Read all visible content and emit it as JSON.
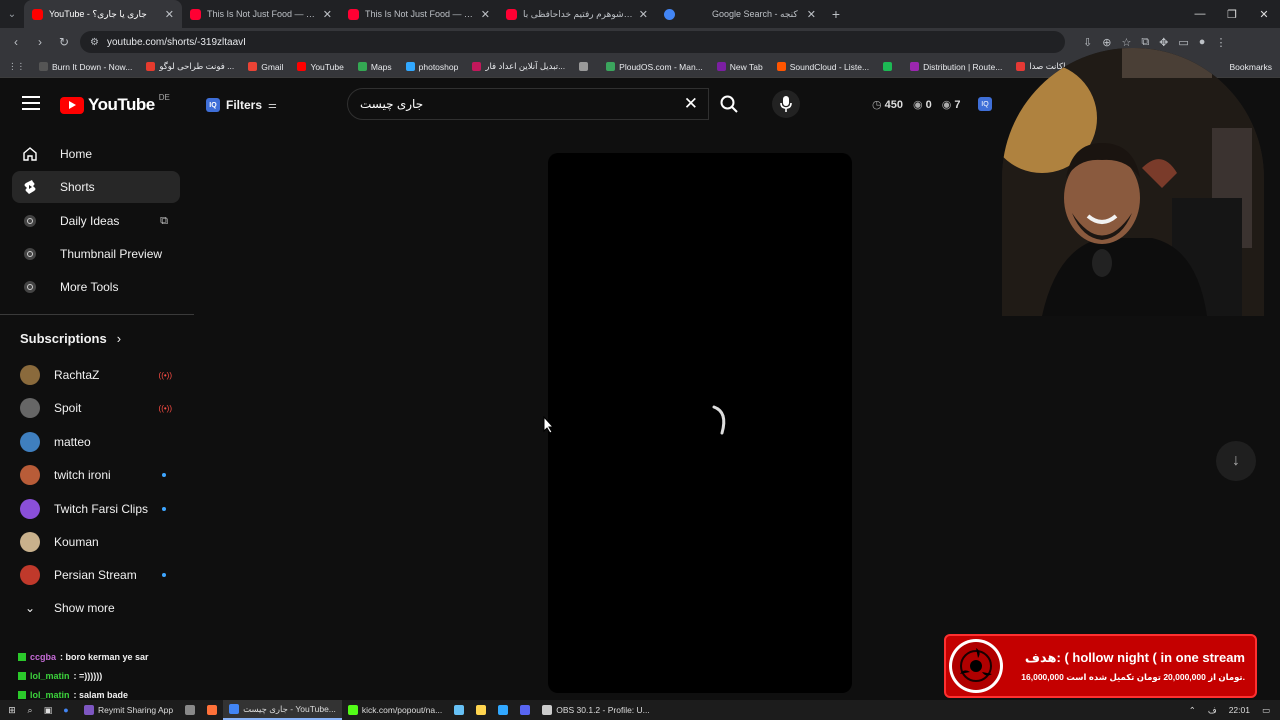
{
  "browser": {
    "tabs": [
      {
        "title": "YouTube - جاری یا جاری؟",
        "color": "#ff0000",
        "active": true
      },
      {
        "title": "This Is Not Just Food — This Is",
        "color": "#ff0033",
        "active": false
      },
      {
        "title": "This Is Not Just Food — This Is",
        "color": "#ff0033",
        "active": false
      },
      {
        "title": "با مادرشوهرم رفتیم خداحافظی با",
        "color": "#ff0033",
        "active": false
      },
      {
        "title": "",
        "color": "#4285f4",
        "active": false
      },
      {
        "title": "Google Search - کنجه",
        "color": "#4285f4",
        "active": false
      }
    ],
    "url": "youtube.com/shorts/-319zltaavI",
    "bookmarks": [
      {
        "label": "Burn It Down - Now...",
        "color": "#555"
      },
      {
        "label": "فونت طراحی لوگو ...",
        "color": "#e63b2e"
      },
      {
        "label": "Gmail",
        "color": "#ea4335"
      },
      {
        "label": "YouTube",
        "color": "#ff0000"
      },
      {
        "label": "Maps",
        "color": "#34a853"
      },
      {
        "label": "photoshop",
        "color": "#31a8ff"
      },
      {
        "label": "تبدیل آنلاین اعداد فار...",
        "color": "#c2185b"
      },
      {
        "label": "",
        "color": "#999"
      },
      {
        "label": "PloudOS.com - Man...",
        "color": "#3ba55d"
      },
      {
        "label": "New Tab",
        "color": "#7b1fa2"
      },
      {
        "label": "SoundCloud - Liste...",
        "color": "#ff5500"
      },
      {
        "label": "",
        "color": "#1db954"
      },
      {
        "label": "Distribution | Route...",
        "color": "#9c27b0"
      },
      {
        "label": "اکانت صدا...",
        "color": "#e53935"
      }
    ],
    "bookmarks_more": "Bookmarks"
  },
  "youtube": {
    "logo_text": "YouTube",
    "region": "DE",
    "filters_label": "Filters",
    "search_value": "جاری چیست",
    "stats": {
      "time": "450",
      "views": "0",
      "watched": "7"
    }
  },
  "sidebar": {
    "items": [
      {
        "label": "Home",
        "icon": "home-icon"
      },
      {
        "label": "Shorts",
        "icon": "shorts-icon",
        "selected": true
      },
      {
        "label": "Daily Ideas",
        "icon": "iq-icon"
      },
      {
        "label": "Thumbnail Preview",
        "icon": "iq-icon"
      },
      {
        "label": "More Tools",
        "icon": "iq-icon"
      }
    ],
    "subscriptions_label": "Subscriptions",
    "subscriptions": [
      {
        "name": "RachtaZ",
        "status": "live",
        "color": "#8a6a3c"
      },
      {
        "name": "Spoit",
        "status": "live",
        "color": "#666"
      },
      {
        "name": "matteo",
        "status": "",
        "color": "#3f7fbf"
      },
      {
        "name": "twitch ironi",
        "status": "new",
        "color": "#b85c38"
      },
      {
        "name": "Twitch Farsi Clips",
        "status": "new",
        "color": "#8a4fd8"
      },
      {
        "name": "Kouman",
        "status": "",
        "color": "#c9b18c"
      },
      {
        "name": "Persian Stream",
        "status": "new",
        "color": "#c0392b"
      }
    ],
    "show_more": "Show more"
  },
  "chat": [
    {
      "user": "ccgba",
      "text": ": boro kerman ye sar",
      "color": "#c56bd6"
    },
    {
      "user": "lol_matin",
      "text": ": =))))))",
      "color": "#3cd23c"
    },
    {
      "user": "lol_matin",
      "text": ": salam bade",
      "color": "#3cd23c"
    }
  ],
  "donation_goal": {
    "title": "هدف: ( hollow night ( in one stream",
    "progress": "16,000,000 تومان از 20,000,000 تومان تکمیل شده است."
  },
  "taskbar": {
    "apps": [
      {
        "label": "Reymit Sharing App",
        "color": "#7e57c2",
        "active": false
      },
      {
        "label": "",
        "color": "#888",
        "active": false
      },
      {
        "label": "",
        "color": "#ff7139",
        "active": false
      },
      {
        "label": "جاری چیست - YouTube...",
        "color": "#4285f4",
        "active": true
      },
      {
        "label": "kick.com/popout/na...",
        "color": "#53fc18",
        "active": false
      },
      {
        "label": "",
        "color": "#66c0f4",
        "active": false
      },
      {
        "label": "",
        "color": "#ffd54f",
        "active": false
      },
      {
        "label": "",
        "color": "#31a8ff",
        "active": false
      },
      {
        "label": "",
        "color": "#5865f2",
        "active": false
      },
      {
        "label": "OBS 30.1.2 - Profile: U...",
        "color": "#ccc",
        "active": false
      }
    ],
    "lang": "ف",
    "clock": "22:01"
  }
}
